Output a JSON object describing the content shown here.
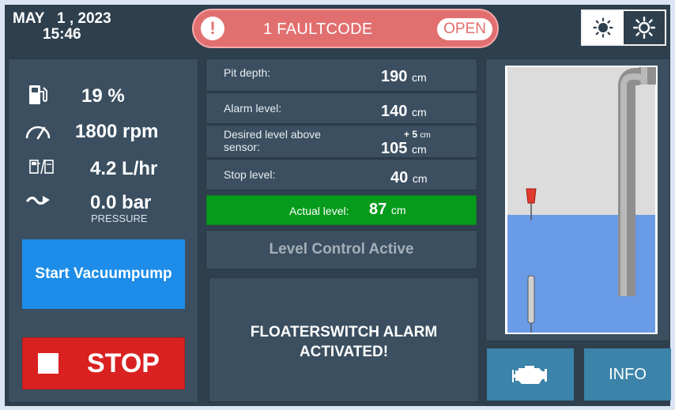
{
  "header": {
    "date": "MAY   1 , 2023",
    "time": "15:46",
    "fault_text": "1 FAULTCODE",
    "fault_open_label": "OPEN",
    "fault_icon": "exclamation-icon",
    "brightness_down_icon": "sun-small-icon",
    "brightness_up_icon": "sun-large-icon"
  },
  "left_panel": {
    "fuel": {
      "icon": "fuel-pump-icon",
      "value": "19 %"
    },
    "rpm": {
      "icon": "gauge-icon",
      "value": "1800 rpm"
    },
    "consumption": {
      "icon": "fuel-consumption-icon",
      "value": "4.2 L/hr"
    },
    "pressure": {
      "icon": "pressure-trend-icon",
      "value": "0.0 bar",
      "sub_label": "PRESSURE"
    },
    "start_button_label": "Start Vacuumpump",
    "stop_button_label": "STOP"
  },
  "levels": {
    "pit_depth": {
      "label": "Pit depth:",
      "value": "190",
      "unit": "cm"
    },
    "alarm_level": {
      "label": "Alarm level:",
      "value": "140",
      "unit": "cm"
    },
    "desired_level": {
      "label_line1": "Desired level above",
      "label_line2": "sensor:",
      "offset": "+ 5",
      "offset_unit": "cm",
      "value": "105",
      "unit": "cm"
    },
    "stop_level": {
      "label": "Stop level:",
      "value": "40",
      "unit": "cm"
    },
    "actual_level": {
      "label": "Actual level:",
      "value": "87",
      "unit": "cm"
    }
  },
  "status": {
    "level_control": "Level Control Active",
    "alarm_line1": "FLOATERSWITCH ALARM",
    "alarm_line2": "ACTIVATED!"
  },
  "tank": {
    "water_color": "#6a9be6",
    "air_color": "#dcdcdc",
    "float_color": "#e03a2e"
  },
  "buttons": {
    "engine_icon": "engine-icon",
    "info_label": "INFO"
  },
  "colors": {
    "background": "#2e3f4e",
    "fault": "#e26f6f",
    "start": "#1d8de9",
    "stop": "#d92121",
    "actual": "#079b1c",
    "button": "#3b83a9"
  }
}
